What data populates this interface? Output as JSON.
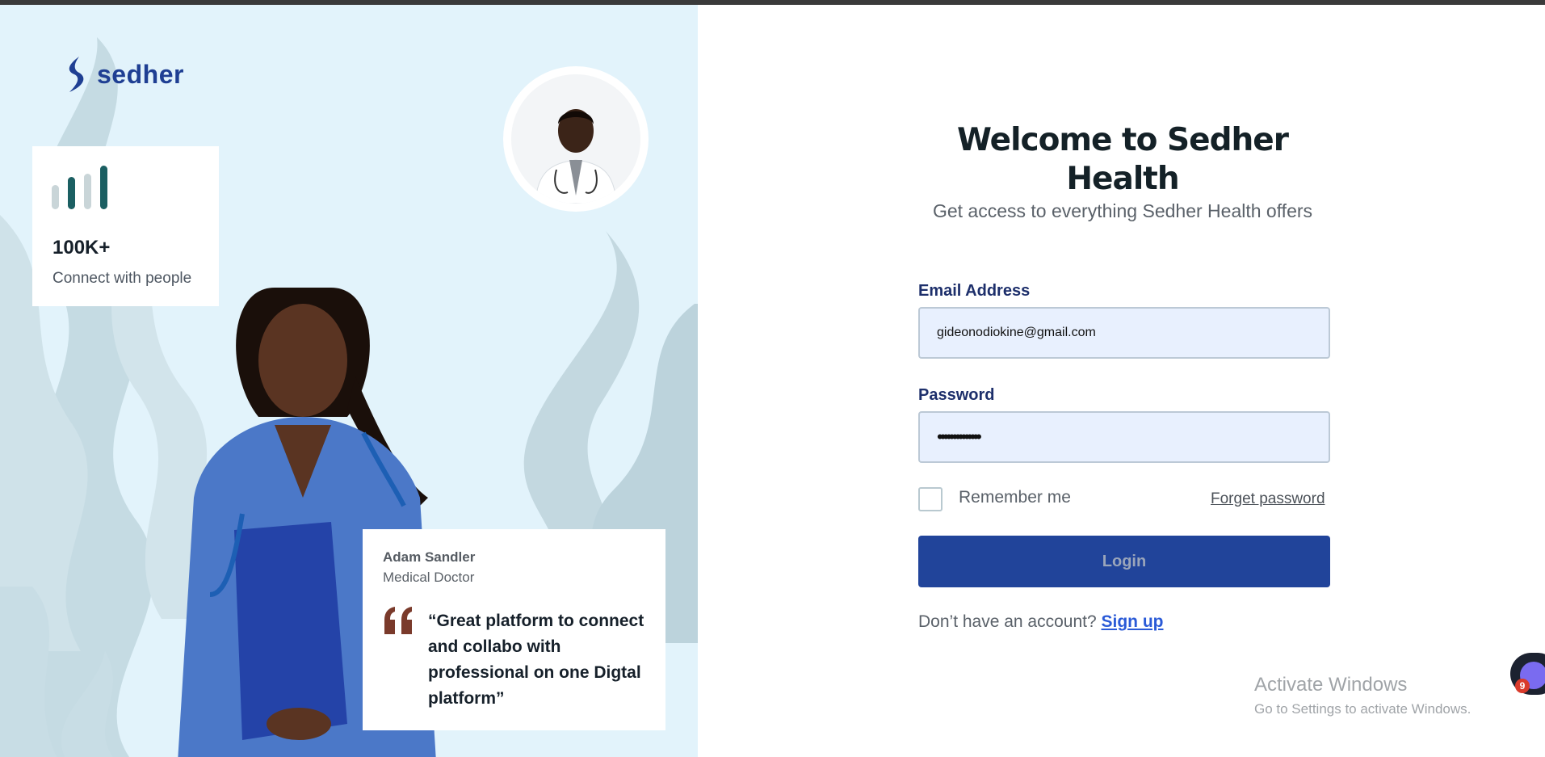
{
  "brand": {
    "name": "sedher"
  },
  "stats": {
    "value": "100K+",
    "caption": "Connect with people"
  },
  "testimonial": {
    "name": "Adam Sandler",
    "role": "Medical Doctor",
    "quote": "“Great platform to connect and collabo with professional on one Digtal platform”"
  },
  "form": {
    "title": "Welcome to Sedher Health",
    "subtitle": "Get access to everything Sedher Health offers",
    "email_label": "Email Address",
    "email_value": "gideonodiokine@gmail.com",
    "password_label": "Password",
    "password_value": "••••••••••••••",
    "remember_label": "Remember me",
    "forget_label": "Forget password",
    "login_label": "Login",
    "no_account_text": "Don’t have an account?",
    "signup_label": "Sign up"
  },
  "watermark": {
    "line1": "Activate Windows",
    "line2": "Go to Settings to activate Windows."
  },
  "chat": {
    "badge_count": "9",
    "icon": "chat-bot-icon"
  },
  "colors": {
    "brand_blue": "#21449a",
    "panel_bg": "#e2f3fb",
    "accent_teal": "#1b5f62"
  }
}
